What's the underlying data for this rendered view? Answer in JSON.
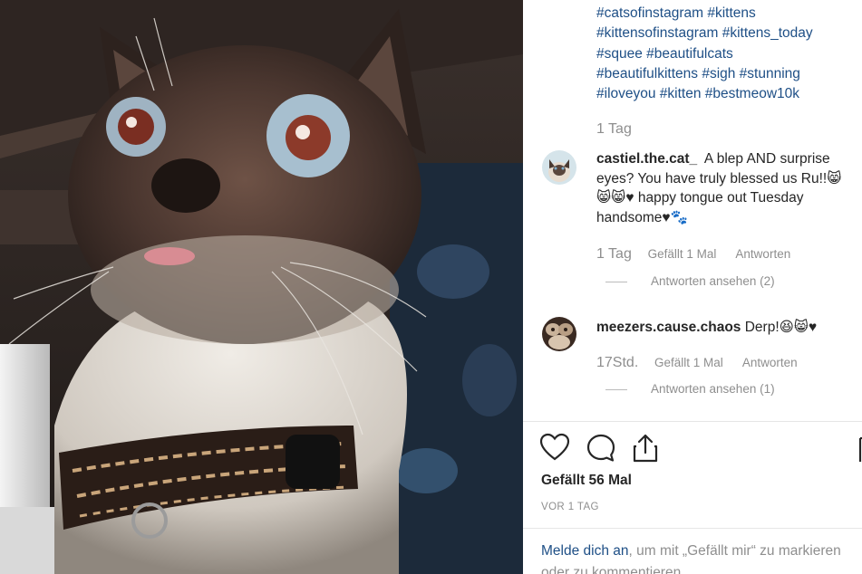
{
  "post": {
    "hashtag_lines": [
      "#catsofinstagram #kittens",
      "#kittensofinstagram #kittens_today",
      "#squee #beautifulcats",
      "#beautifulkittens #sigh #stunning",
      "#iloveyou #kitten #bestmeow10k"
    ],
    "time": "1 Tag"
  },
  "comments": [
    {
      "username": "castiel.the.cat_",
      "text_line1": "A blep AND surprise",
      "text_line2": "eyes? You have truly blessed us Ru!!😸",
      "text_line3": "😸😸♥ happy tongue out Tuesday",
      "text_line4": "handsome♥🐾",
      "time": "1 Tag",
      "likes": "Gefällt 1 Mal",
      "reply": "Antworten",
      "view_replies": "Antworten ansehen (2)"
    },
    {
      "username": "meezers.cause.chaos",
      "text": "Derp!😆😸♥",
      "time": "17Std.",
      "likes": "Gefällt 1 Mal",
      "reply": "Antworten",
      "view_replies": "Antworten ansehen (1)"
    }
  ],
  "likes_count": "Gefällt 56 Mal",
  "post_date": "VOR 1 TAG",
  "login_prompt": {
    "link": "Melde dich an",
    "rest_line1": ", um mit „Gefällt mir“ zu markieren",
    "rest_line2": "oder zu kommentieren."
  },
  "icons": {
    "like": "heart-icon",
    "comment": "comment-icon",
    "share": "share-icon",
    "save": "bookmark-icon"
  },
  "colors": {
    "link": "#1e4f86",
    "muted": "#8e8e8e",
    "text": "#262626"
  }
}
